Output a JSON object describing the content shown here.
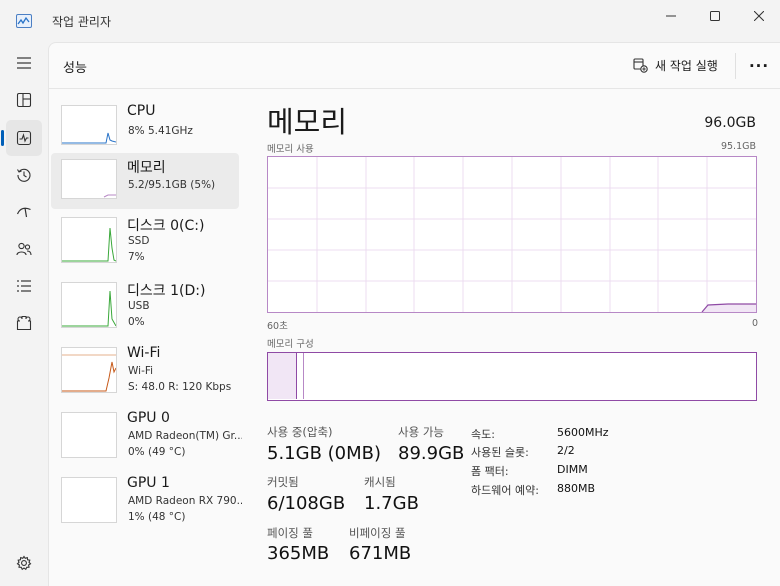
{
  "window": {
    "title": "작업 관리자"
  },
  "header": {
    "page_title": "성능",
    "run_task_label": "새 작업 실행",
    "more_label": "···"
  },
  "colors": {
    "memory_accent": "#8f4aa5",
    "memory_light": "#b788c6",
    "cpu_line": "#2a74c8",
    "disk_line": "#3aa83a",
    "wifi_line": "#c75a1a",
    "nav_indicator": "#005fb8"
  },
  "nav_icons": [
    "hamburger-icon",
    "processes-icon",
    "performance-icon",
    "app-history-icon",
    "startup-icon",
    "users-icon",
    "details-icon",
    "services-icon",
    "settings-icon"
  ],
  "resources": [
    {
      "name": "CPU",
      "line1": "8% 5.41GHz",
      "line2": ""
    },
    {
      "name": "메모리",
      "line1": "5.2/95.1GB (5%)",
      "line2": ""
    },
    {
      "name": "디스크 0(C:)",
      "line1": "SSD",
      "line2": "7%"
    },
    {
      "name": "디스크 1(D:)",
      "line1": "USB",
      "line2": "0%"
    },
    {
      "name": "Wi-Fi",
      "line1": "Wi-Fi",
      "line2": "S: 48.0 R: 120 Kbps"
    },
    {
      "name": "GPU 0",
      "line1": "AMD Radeon(TM) Gr...",
      "line2": "0% (49 °C)"
    },
    {
      "name": "GPU 1",
      "line1": "AMD Radeon RX 790...",
      "line2": "1% (48 °C)"
    }
  ],
  "detail": {
    "title": "메모리",
    "total": "96.0GB",
    "usage_label": "메모리 사용",
    "max_label": "95.1GB",
    "time_left": "60초",
    "time_right": "0",
    "composition_label": "메모리 구성",
    "stats": {
      "in_use_label": "사용 중(압축)",
      "in_use_value": "5.1GB (0MB)",
      "available_label": "사용 가능",
      "available_value": "89.9GB",
      "committed_label": "커밋됨",
      "committed_value": "6/108GB",
      "cached_label": "캐시됨",
      "cached_value": "1.7GB",
      "paged_label": "페이징 풀",
      "paged_value": "365MB",
      "nonpaged_label": "비페이징 풀",
      "nonpaged_value": "671MB"
    },
    "specs": [
      {
        "key": "속도:",
        "value": "5600MHz"
      },
      {
        "key": "사용된 슬롯:",
        "value": "2/2"
      },
      {
        "key": "폼 팩터:",
        "value": "DIMM"
      },
      {
        "key": "하드웨어 예약:",
        "value": "880MB"
      }
    ]
  }
}
